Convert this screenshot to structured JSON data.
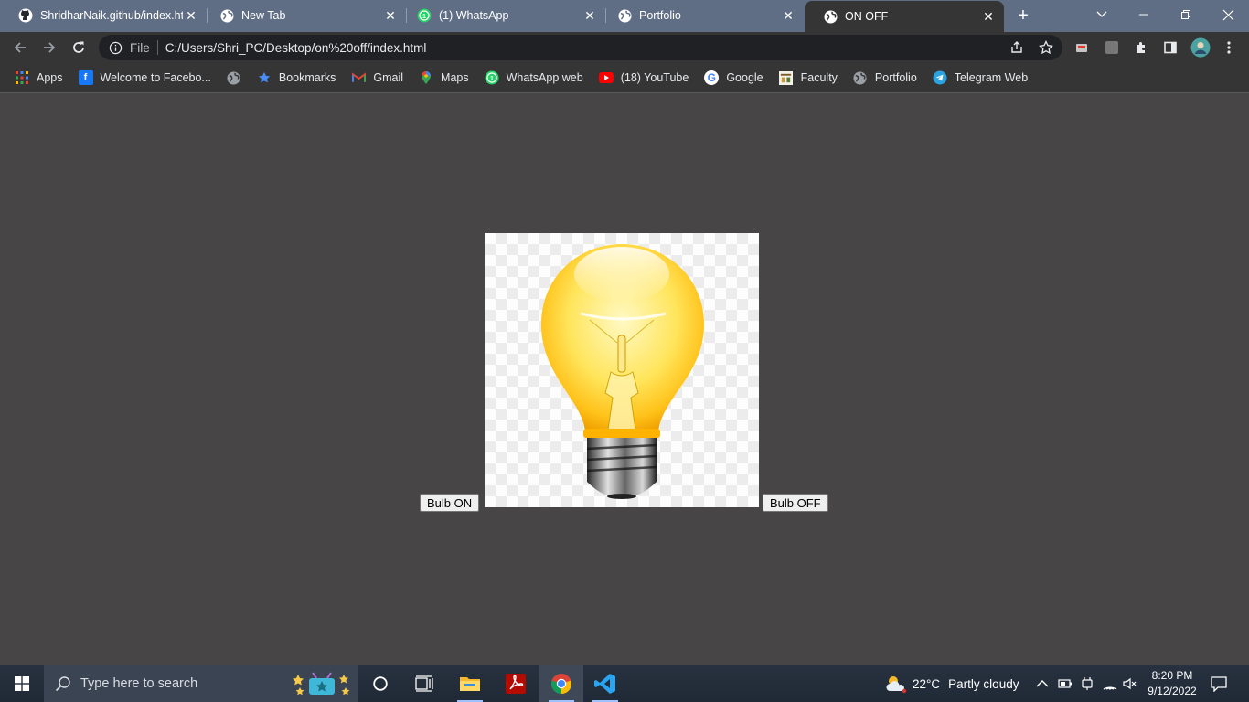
{
  "tabs": [
    {
      "title": "ShridharNaik.github/index.html",
      "icon": "github-icon",
      "active": false
    },
    {
      "title": "New Tab",
      "icon": "globe-icon",
      "active": false
    },
    {
      "title": "(1) WhatsApp",
      "icon": "whatsapp-icon",
      "active": false
    },
    {
      "title": "Portfolio",
      "icon": "globe-icon",
      "active": false
    },
    {
      "title": "ON OFF",
      "icon": "globe-icon",
      "active": true
    }
  ],
  "address_bar": {
    "scheme_label": "File",
    "url": "C:/Users/Shri_PC/Desktop/on%20off/index.html"
  },
  "bookmarks": [
    {
      "label": "Apps",
      "icon": "apps-grid-icon"
    },
    {
      "label": "Welcome to Facebo...",
      "icon": "facebook-icon"
    },
    {
      "label": "",
      "icon": "globe-icon"
    },
    {
      "label": "Bookmarks",
      "icon": "star-icon"
    },
    {
      "label": "Gmail",
      "icon": "gmail-icon"
    },
    {
      "label": "Maps",
      "icon": "maps-pin-icon"
    },
    {
      "label": "WhatsApp web",
      "icon": "whatsapp-icon"
    },
    {
      "label": "(18) YouTube",
      "icon": "youtube-icon"
    },
    {
      "label": "Google",
      "icon": "google-icon"
    },
    {
      "label": "Faculty",
      "icon": "faculty-icon"
    },
    {
      "label": "Portfolio",
      "icon": "globe-icon"
    },
    {
      "label": "Telegram Web",
      "icon": "telegram-icon"
    }
  ],
  "page": {
    "bulb_on_label": "Bulb ON",
    "bulb_off_label": "Bulb OFF",
    "bulb_state": "on"
  },
  "taskbar": {
    "search_placeholder": "Type here to search",
    "apps": [
      "cortana-icon",
      "task-view-icon",
      "file-explorer-icon",
      "acrobat-icon",
      "chrome-icon",
      "vscode-icon"
    ],
    "active_app": "chrome-icon",
    "weather_temp": "22°C",
    "weather_desc": "Partly cloudy",
    "time": "8:20 PM",
    "date": "9/12/2022"
  },
  "colors": {
    "tabstrip": "#5f6e84",
    "toolbar": "#353535",
    "page_bg": "#474546",
    "taskbar": "#222c39"
  }
}
